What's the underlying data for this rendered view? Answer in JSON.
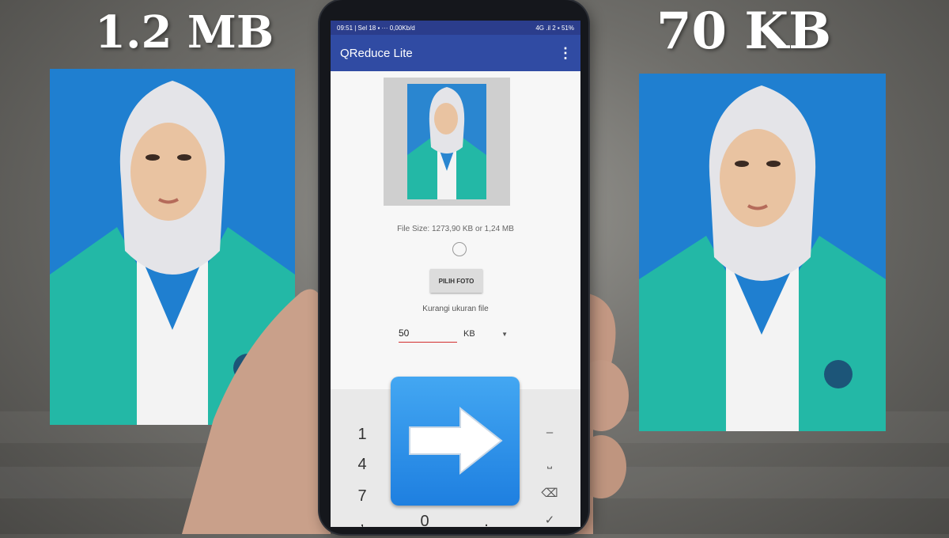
{
  "captions": {
    "before": "1.2 MB",
    "after": "70 KB"
  },
  "status_bar": {
    "left": "09:51 | Sel 18 ▪ ··· 0,00Kb/d",
    "right": "4G .il 2 ▪ 51%"
  },
  "app": {
    "title": "QReduce Lite",
    "menu_icon": "more-vert-icon",
    "file_size_text": "File Size: 1273,90 KB or 1,24 MB",
    "pick_button_label": "PILIH FOTO",
    "reduce_label": "Kurangi ukuran file",
    "size_input_value": "50",
    "unit_selected": "KB"
  },
  "keypad": {
    "keys": [
      "1",
      "4",
      "7",
      ",",
      "0",
      "."
    ],
    "right_keys": {
      "minus": "–",
      "space": "⎵",
      "backspace": "⌫",
      "done": "✓"
    }
  },
  "colors": {
    "app_bar": "#304ba3",
    "status_bar": "#2b3d8c",
    "photo_background": "#1f7fd0",
    "jacket": "#23b8a6",
    "arrow_badge": "#2e90e8"
  }
}
